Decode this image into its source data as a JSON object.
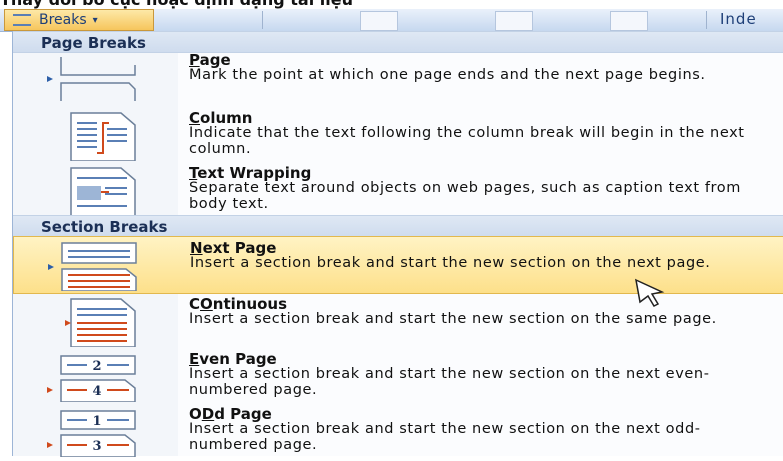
{
  "caption": "Thay đổi bố cục hoặc định dạng tài liệu",
  "ribbon": {
    "breaks_label": "Breaks",
    "chevron": "▾",
    "index_label": "Inde"
  },
  "sections": [
    {
      "header": "Page Breaks",
      "items": [
        {
          "title_u": "P",
          "title_rest": "age",
          "desc": "Mark the point at which one page ends and the next page begins.",
          "icon": "page-break-icon"
        },
        {
          "title_u": "C",
          "title_rest": "olumn",
          "desc": "Indicate that the text following the column break will begin in the next column.",
          "icon": "column-break-icon"
        },
        {
          "title_u": "T",
          "title_rest": "ext Wrapping",
          "desc": "Separate text around objects on web pages, such as caption text from body text.",
          "icon": "text-wrapping-icon"
        }
      ]
    },
    {
      "header": "Section Breaks",
      "items": [
        {
          "title_u": "N",
          "title_rest": "ext Page",
          "desc": "Insert a section break and start the new section on the next page.",
          "icon": "next-page-icon",
          "highlighted": true
        },
        {
          "title_u": "O",
          "title_rest": "ntinuous",
          "title_pre": "C",
          "desc": "Insert a section break and start the new section on the same page.",
          "icon": "continuous-icon"
        },
        {
          "title_u": "E",
          "title_rest": "ven Page",
          "desc": "Insert a section break and start the new section on the next even-numbered page.",
          "icon": "even-page-icon",
          "num_top": "2",
          "num_bottom": "4"
        },
        {
          "title_u": "D",
          "title_rest": "d Page",
          "title_pre": "O",
          "desc": "Insert a section break and start the new section on the next odd-numbered page.",
          "icon": "odd-page-icon",
          "num_top": "1",
          "num_bottom": "3"
        }
      ]
    }
  ],
  "colors": {
    "highlight": "#fde08a",
    "header_bg": "#dfe8f4",
    "accent_red": "#d04a1c",
    "icon_blue": "#5a7fb5"
  }
}
